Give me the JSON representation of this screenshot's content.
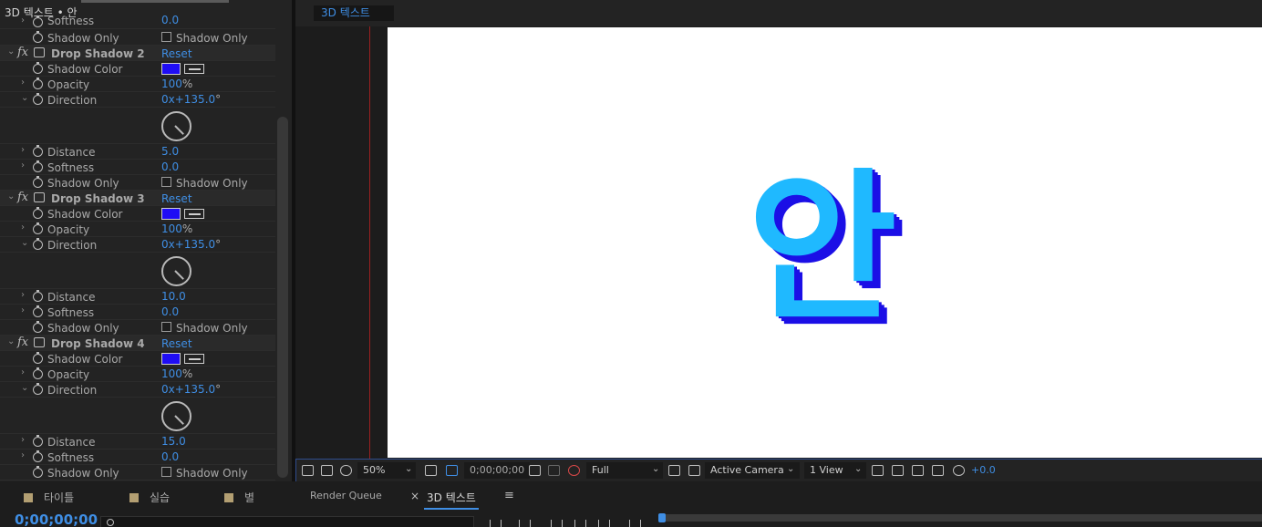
{
  "effects_panel": {
    "title": "3D 텍스트 • 안",
    "prefix_rows": [
      {
        "label": "Softness",
        "value": "0.0"
      },
      {
        "label": "Shadow Only",
        "checkbox_label": "Shadow Only"
      }
    ],
    "effects": [
      {
        "name": "Drop Shadow 2",
        "reset": "Reset",
        "color_label": "Shadow Color",
        "color": "#1f0df5",
        "opacity_label": "Opacity",
        "opacity": "100",
        "opacity_unit": "%",
        "direction_label": "Direction",
        "direction": "0x+135.0",
        "direction_unit": "°",
        "distance_label": "Distance",
        "distance": "5.0",
        "softness_label": "Softness",
        "softness": "0.0",
        "shadow_only_label": "Shadow Only",
        "shadow_only_checkbox": "Shadow Only"
      },
      {
        "name": "Drop Shadow 3",
        "reset": "Reset",
        "color_label": "Shadow Color",
        "color": "#1f0df5",
        "opacity_label": "Opacity",
        "opacity": "100",
        "opacity_unit": "%",
        "direction_label": "Direction",
        "direction": "0x+135.0",
        "direction_unit": "°",
        "distance_label": "Distance",
        "distance": "10.0",
        "softness_label": "Softness",
        "softness": "0.0",
        "shadow_only_label": "Shadow Only",
        "shadow_only_checkbox": "Shadow Only"
      },
      {
        "name": "Drop Shadow 4",
        "reset": "Reset",
        "color_label": "Shadow Color",
        "color": "#1f0df5",
        "opacity_label": "Opacity",
        "opacity": "100",
        "opacity_unit": "%",
        "direction_label": "Direction",
        "direction": "0x+135.0",
        "direction_unit": "°",
        "distance_label": "Distance",
        "distance": "15.0",
        "softness_label": "Softness",
        "softness": "0.0",
        "shadow_only_label": "Shadow Only",
        "shadow_only_checkbox": "Shadow Only"
      }
    ]
  },
  "viewer": {
    "tab": "3D 텍스트",
    "canvas_text": "안",
    "colors": {
      "text_front": "#1fb9ff",
      "text_shadow": "#1b0fe6",
      "canvas": "#ffffff",
      "accent": "#3f8ee4"
    },
    "toolbar": {
      "zoom": "50%",
      "timecode": "0;00;00;00",
      "resolution": "Full",
      "camera": "Active Camera",
      "view": "1 View",
      "exposure": "+0.0"
    }
  },
  "bottom_tabs": {
    "tabs": [
      "타이틀",
      "실습",
      "별"
    ],
    "render_queue": "Render Queue",
    "close_icon": "×",
    "active": "3D 텍스트",
    "menu_icon": "≡"
  },
  "timeline": {
    "timecode": "0;00;00;00"
  }
}
